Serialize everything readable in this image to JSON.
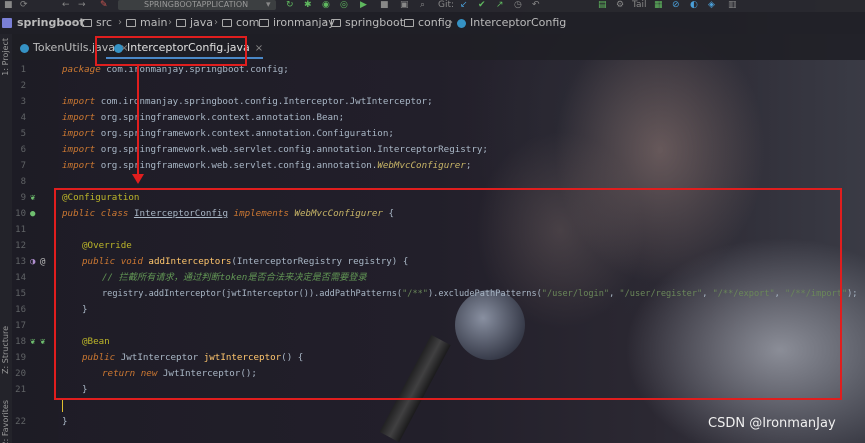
{
  "navbar": {
    "run_config": "SPRINGBOOTAPPLICATION",
    "git_label": "Git:",
    "tail_label": "Tail"
  },
  "breadcrumb": {
    "project": "springboot",
    "items": [
      "src",
      "main",
      "java",
      "com",
      "ironmanjay",
      "springboot",
      "config",
      "InterceptorConfig"
    ]
  },
  "tabs": [
    {
      "label": "TokenUtils.java",
      "close": "×"
    },
    {
      "label": "InterceptorConfig.java",
      "close": "×"
    }
  ],
  "side_labels": {
    "project": "1: Project",
    "structure": "Z: Structure",
    "favorites": "2: Favorites"
  },
  "line_numbers": [
    "1",
    "2",
    "3",
    "4",
    "5",
    "6",
    "7",
    "8",
    "9",
    "10",
    "11",
    "12",
    "13",
    "14",
    "15",
    "16",
    "17",
    "18",
    "19",
    "20",
    "21",
    "22"
  ],
  "code": {
    "l1_kw": "package",
    "l1_rest": " com.ironmanjay.springboot.config;",
    "l3_kw": "import",
    "l3_rest": " com.ironmanjay.springboot.config.Interceptor.JwtInterceptor;",
    "l4_kw": "import",
    "l4_rest": " org.springframework.context.annotation.Bean;",
    "l5_kw": "import",
    "l5_rest": " org.springframework.context.annotation.Configuration;",
    "l6_kw": "import",
    "l6_rest": " org.springframework.web.servlet.config.annotation.InterceptorRegistry;",
    "l7_kw": "import",
    "l7_rest_a": " org.springframework.web.servlet.config.annotation.",
    "l7_rest_b": "WebMvcConfigurer",
    "l7_rest_c": ";",
    "l9_ann": "@Configuration",
    "l10_kw1": "public class",
    "l10_name": "InterceptorConfig",
    "l10_kw2": "implements",
    "l10_iface": "WebMvcConfigurer",
    "l10_brace": " {",
    "l12_ann": "@Override",
    "l13_kw": "public void",
    "l13_fn": "addInterceptors",
    "l13_rest": "(InterceptorRegistry registry) {",
    "l14_cmt": "// 拦截所有请求，通过判断token是否合法来决定是否需要登录",
    "l15_a": "registry.addInterceptor(jwtInterceptor()).addPathPatterns(",
    "l15_s1": "\"/**\"",
    "l15_b": ").excludePathPatterns(",
    "l15_s2": "\"/user/login\"",
    "l15_c": ", ",
    "l15_s3": "\"/user/register\"",
    "l15_d": ", ",
    "l15_s4": "\"/**/export\"",
    "l15_e": ", ",
    "l15_s5": "\"/**/import\"",
    "l15_f": ");",
    "l16_brace": "}",
    "l18_ann": "@Bean",
    "l19_kw": "public",
    "l19_type": " JwtInterceptor ",
    "l19_fn": "jwtInterceptor",
    "l19_rest": "() {",
    "l20_kw1": "return",
    "l20_kw2": "new",
    "l20_rest": " JwtInterceptor();",
    "l21_brace": "}",
    "l22_brace": "}"
  },
  "watermark": "CSDN @IronmanJay",
  "colors": {
    "annotation_red": "#e01e1e",
    "keyword": "#cc7832",
    "string": "#6a8759",
    "comment": "#629755",
    "function": "#ffc66d"
  }
}
